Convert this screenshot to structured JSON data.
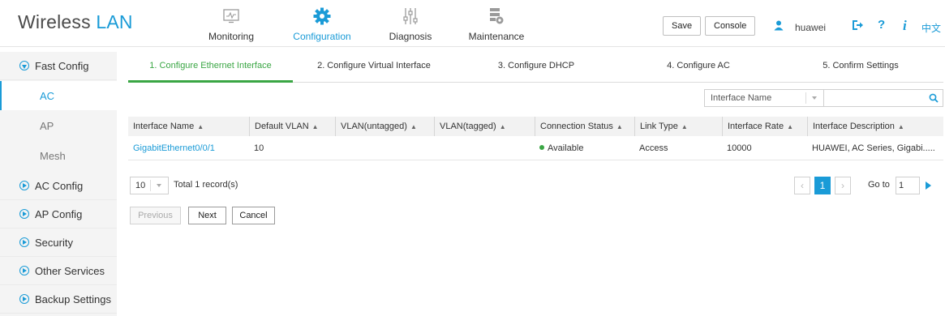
{
  "header": {
    "logo_prefix": "Wireless",
    "logo_suffix": "LAN",
    "nav": [
      {
        "label": "Monitoring",
        "icon": "monitor-icon"
      },
      {
        "label": "Configuration",
        "icon": "gear-icon"
      },
      {
        "label": "Diagnosis",
        "icon": "sliders-icon"
      },
      {
        "label": "Maintenance",
        "icon": "server-gear-icon"
      }
    ],
    "save_label": "Save",
    "console_label": "Console",
    "username": "huawei",
    "help_glyph": "?",
    "info_glyph": "i",
    "language": "中文",
    "accent": "#1a9bd7"
  },
  "sidebar": {
    "items": [
      {
        "label": "Fast Config",
        "expanded": true
      },
      {
        "label": "AC Config"
      },
      {
        "label": "AP Config"
      },
      {
        "label": "Security"
      },
      {
        "label": "Other Services"
      },
      {
        "label": "Backup Settings"
      }
    ],
    "fast_config_children": [
      "AC",
      "AP",
      "Mesh"
    ],
    "active_child": "AC"
  },
  "steps": [
    "1. Configure Ethernet Interface",
    "2. Configure Virtual Interface",
    "3. Configure DHCP",
    "4. Configure AC",
    "5. Confirm Settings"
  ],
  "active_step_color": "#3aa644",
  "filter": {
    "field": "Interface Name",
    "value": ""
  },
  "table": {
    "columns": [
      "Interface Name",
      "Default VLAN",
      "VLAN(untagged)",
      "VLAN(tagged)",
      "Connection Status",
      "Link Type",
      "Interface Rate",
      "Interface Description"
    ],
    "rows": [
      [
        "GigabitEthernet0/0/1",
        "10",
        "",
        "",
        "Available",
        "Access",
        "10000",
        "HUAWEI, AC Series, Gigabi....."
      ]
    ]
  },
  "pagination": {
    "page_size": "10",
    "total": "Total 1 record(s)",
    "current_page": "1",
    "goto_label": "Go to",
    "goto_value": "1"
  },
  "wizard": {
    "previous": "Previous",
    "next": "Next",
    "cancel": "Cancel"
  }
}
